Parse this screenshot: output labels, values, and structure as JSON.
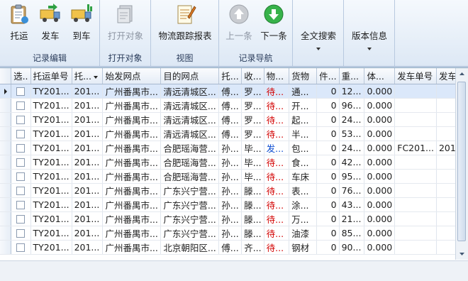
{
  "ribbon": {
    "groups": [
      {
        "label": "记录编辑",
        "buttons": [
          "托运",
          "发车",
          "到车"
        ]
      },
      {
        "label": "打开对象",
        "buttons": [
          "打开对象"
        ]
      },
      {
        "label": "视图",
        "buttons": [
          "物流跟踪报表"
        ]
      },
      {
        "label": "记录导航",
        "buttons": [
          "上一条",
          "下一条"
        ]
      },
      {
        "label": "",
        "buttons": [
          "全文搜索"
        ]
      },
      {
        "label": "",
        "buttons": [
          "版本信息"
        ]
      }
    ]
  },
  "grid": {
    "columns": [
      "选..",
      "托运单号",
      "托...",
      "始发网点",
      "目的网点",
      "托...",
      "收...",
      "物...",
      "货物",
      "件...",
      "重...",
      "体...",
      "发车单号",
      "发车..."
    ],
    "rows": [
      [
        "TY201...",
        "201...",
        "广州番禺市...",
        "清远清城区...",
        "傅...",
        "罗...",
        "待...",
        "通...",
        "0",
        "12...",
        "0.000",
        "",
        ""
      ],
      [
        "TY201...",
        "201...",
        "广州番禺市...",
        "清远清城区...",
        "傅...",
        "罗...",
        "待...",
        "开...",
        "0",
        "96...",
        "0.000",
        "",
        ""
      ],
      [
        "TY201...",
        "201...",
        "广州番禺市...",
        "清远清城区...",
        "傅...",
        "罗...",
        "待...",
        "起...",
        "0",
        "24...",
        "0.000",
        "",
        ""
      ],
      [
        "TY201...",
        "201...",
        "广州番禺市...",
        "清远清城区...",
        "傅...",
        "罗...",
        "待...",
        "半...",
        "0",
        "53...",
        "0.000",
        "",
        ""
      ],
      [
        "TY201...",
        "201...",
        "广州番禺市...",
        "合肥瑶海营...",
        "孙...",
        "毕...",
        "发...",
        "包...",
        "0",
        "24...",
        "0.000",
        "FC201...",
        "201..."
      ],
      [
        "TY201...",
        "201...",
        "广州番禺市...",
        "合肥瑶海营...",
        "孙...",
        "毕...",
        "待...",
        "食...",
        "0",
        "42...",
        "0.000",
        "",
        ""
      ],
      [
        "TY201...",
        "201...",
        "广州番禺市...",
        "合肥瑶海营...",
        "孙...",
        "毕...",
        "待...",
        "车床",
        "0",
        "95...",
        "0.000",
        "",
        ""
      ],
      [
        "TY201...",
        "201...",
        "广州番禺市...",
        "广东兴宁营...",
        "孙...",
        "滕...",
        "待...",
        "表...",
        "0",
        "76...",
        "0.000",
        "",
        ""
      ],
      [
        "TY201...",
        "201...",
        "广州番禺市...",
        "广东兴宁营...",
        "孙...",
        "滕...",
        "待...",
        "涂...",
        "0",
        "43...",
        "0.000",
        "",
        ""
      ],
      [
        "TY201...",
        "201...",
        "广州番禺市...",
        "广东兴宁营...",
        "孙...",
        "滕...",
        "待...",
        "万...",
        "0",
        "21...",
        "0.000",
        "",
        ""
      ],
      [
        "TY201...",
        "201...",
        "广州番禺市...",
        "广东兴宁营...",
        "孙...",
        "滕...",
        "待...",
        "油漆",
        "0",
        "85...",
        "0.000",
        "",
        ""
      ],
      [
        "TY201...",
        "201...",
        "广州番禺市...",
        "北京朝阳区...",
        "傅...",
        "齐...",
        "待...",
        "钢材",
        "0",
        "90...",
        "0.000",
        "",
        ""
      ]
    ],
    "status_colors": {
      "待...": "#d20000",
      "发...": "#0a4bd0"
    }
  }
}
